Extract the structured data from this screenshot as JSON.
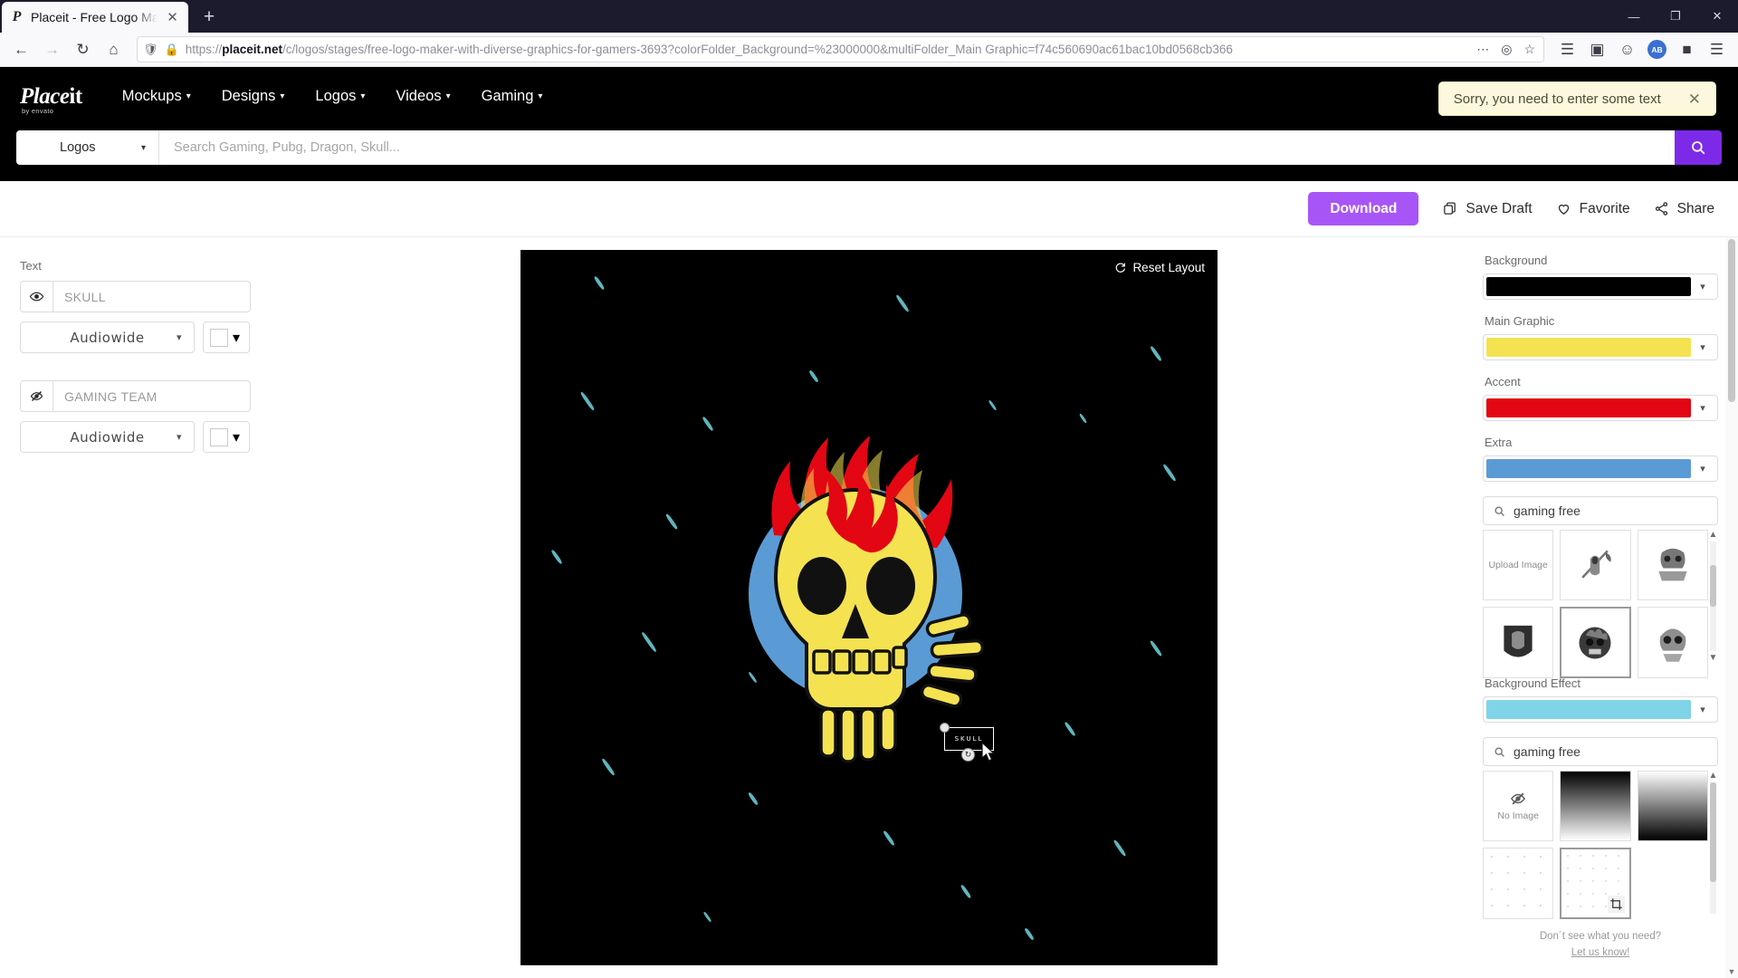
{
  "browser": {
    "tab": {
      "title": "Placeit - Free Logo Maker with",
      "favicon": "P"
    },
    "new_tab_label": "+",
    "url_prefix": "https://",
    "url_domain": "placeit.net",
    "url_path": "/c/logos/stages/free-logo-maker-with-diverse-graphics-for-gamers-3693?colorFolder_Background=%23000000&multiFolder_Main Graphic=f74c560690ac61bac10bd0568cb366",
    "avatar_initials": "AB",
    "window_controls": {
      "minimize": "—",
      "maximize": "❐",
      "close": "✕"
    }
  },
  "header": {
    "logo_main": "Place",
    "logo_it": "it",
    "logo_sub": "by envato",
    "nav": [
      {
        "label": "Mockups"
      },
      {
        "label": "Designs"
      },
      {
        "label": "Logos"
      },
      {
        "label": "Videos"
      },
      {
        "label": "Gaming"
      }
    ],
    "toast": {
      "message": "Sorry, you need to enter some text",
      "close": "✕"
    }
  },
  "search": {
    "category": "Logos",
    "placeholder": "Search Gaming, Pubg, Dragon, Skull..."
  },
  "actionbar": {
    "download": "Download",
    "save_draft": "Save Draft",
    "favorite": "Favorite",
    "share": "Share"
  },
  "left_panel": {
    "section_label": "Text",
    "rows": [
      {
        "value": "SKULL",
        "font": "Audiowide",
        "visible": true
      },
      {
        "value": "GAMING TEAM",
        "font": "Audiowide",
        "visible": false
      }
    ]
  },
  "canvas": {
    "reset_layout": "Reset Layout",
    "background_color": "#000000",
    "selected_text": "SKULL"
  },
  "right_panel": {
    "colors": [
      {
        "label": "Background",
        "value": "#000000"
      },
      {
        "label": "Main Graphic",
        "value": "#f5e251"
      },
      {
        "label": "Accent",
        "value": "#e30613"
      },
      {
        "label": "Extra",
        "value": "#5b9bd5"
      }
    ],
    "graphic_search": {
      "value": "gaming free",
      "icon": "search-icon"
    },
    "graphic_thumbs": [
      {
        "label": "Upload Image",
        "kind": "upload"
      },
      {
        "label": "",
        "kind": "reaper"
      },
      {
        "label": "",
        "kind": "skull-burst"
      },
      {
        "label": "",
        "kind": "soldier"
      },
      {
        "label": "",
        "kind": "flame-skull",
        "selected": true
      },
      {
        "label": "",
        "kind": "brain-skull"
      }
    ],
    "effect_label": "Background Effect",
    "effect_color": "#7fd4e8",
    "effect_search": {
      "value": "gaming free",
      "icon": "search-icon"
    },
    "effect_thumbs": [
      {
        "label": "No Image",
        "kind": "no-image"
      },
      {
        "label": "",
        "kind": "gradient-dark-top"
      },
      {
        "label": "",
        "kind": "gradient-dark-bottom"
      },
      {
        "label": "",
        "kind": "sparse-dots"
      },
      {
        "label": "",
        "kind": "dots-crop",
        "selected": true
      }
    ],
    "footer_question": "Don´t see what you need?",
    "footer_link": "Let us know!"
  }
}
